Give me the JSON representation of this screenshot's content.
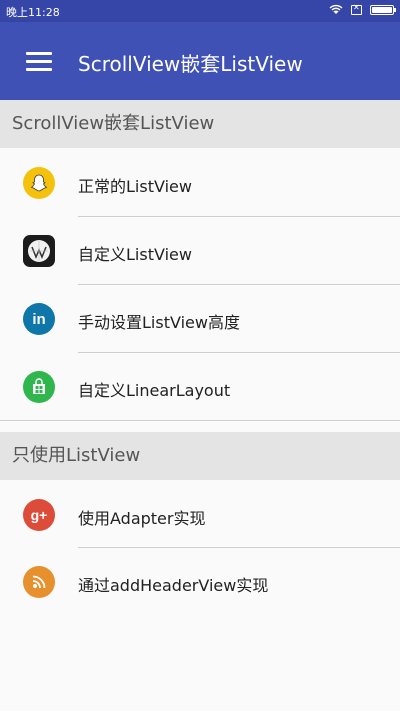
{
  "status_bar": {
    "time": "晚上11:28"
  },
  "toolbar": {
    "title": "ScrollView嵌套ListView"
  },
  "sections": [
    {
      "header": "ScrollView嵌套ListView",
      "items": [
        {
          "label": "正常的ListView",
          "icon": "snapchat-icon",
          "color": "#f4c20d"
        },
        {
          "label": "自定义ListView",
          "icon": "wikipedia-icon",
          "color": "#1c1c1c"
        },
        {
          "label": "手动设置ListView高度",
          "icon": "linkedin-icon",
          "color": "#0e76a8"
        },
        {
          "label": "自定义LinearLayout",
          "icon": "windows-store-icon",
          "color": "#2fb74d"
        }
      ]
    },
    {
      "header": "只使用ListView",
      "items": [
        {
          "label": "使用Adapter实现",
          "icon": "google-plus-icon",
          "color": "#dd4b39"
        },
        {
          "label": "通过addHeaderView实现",
          "icon": "rss-icon",
          "color": "#e6912e"
        }
      ]
    }
  ],
  "colors": {
    "toolbar": "#3f51b5",
    "status_bar": "#3546a8",
    "section_header": "#e4e4e4"
  }
}
